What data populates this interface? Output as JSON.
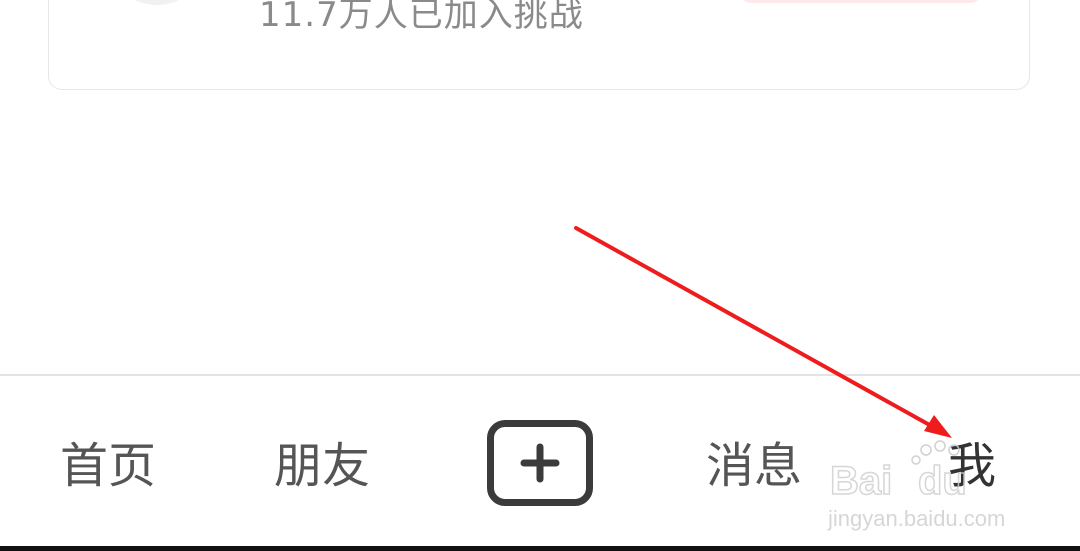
{
  "card": {
    "subtitle": "11.7万人已加入挑战"
  },
  "tabbar": {
    "tabs": [
      {
        "label": "首页"
      },
      {
        "label": "朋友"
      },
      {
        "label": "消息"
      },
      {
        "label": "我"
      }
    ],
    "add_icon": "plus-icon"
  },
  "annotation": {
    "arrow_color": "#ee1c1c"
  },
  "watermark": {
    "brand": "Baidu经验",
    "url": "jingyan.baidu.com"
  }
}
